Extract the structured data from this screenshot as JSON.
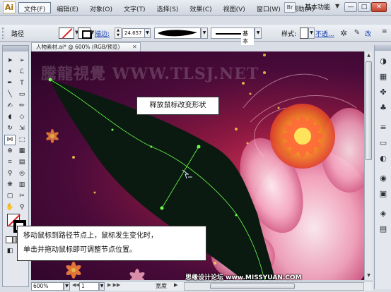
{
  "app": {
    "logo": "Ai",
    "workspace": "基本功能",
    "bridge": "Br"
  },
  "menu": [
    "文件(F)",
    "编辑(E)",
    "对象(O)",
    "文字(T)",
    "选择(S)",
    "效果(C)",
    "视图(V)",
    "窗口(W)",
    "帮助(H)"
  ],
  "window_controls": {
    "minimize": "—",
    "maximize": "□",
    "close": "✕"
  },
  "controlbar": {
    "object_type": "路径",
    "stroke_label": "描边:",
    "stroke_weight": "24.657",
    "profile_label": "基本",
    "style_label": "样式:",
    "opacity_label": "不透...",
    "style_text": "改",
    "menu": "≡"
  },
  "document": {
    "tab_title": "人物素材.ai* @ 600% (RGB/预览)",
    "close": "✕"
  },
  "canvas": {
    "watermark": "騰龍視覺 WWW.TLSJ.NET"
  },
  "callouts": {
    "top": "释放鼠标改变形状",
    "bottom_line1": "移动鼠标到路径节点上，鼠标发生变化时，",
    "bottom_line2": "单击并拖动鼠标即可调整节点位置。"
  },
  "statusbar": {
    "zoom": "600%",
    "page": "1",
    "status": "宽度",
    "site": "思缘设计论坛 www.MISSYUAN.COM"
  },
  "icons": {
    "gear": "gear-icon",
    "graphic_style": "graphic-style-icon"
  },
  "colors": {
    "accent_link": "#1740b0",
    "path_stroke": "#6cff4a",
    "shape_fill": "#0b1a10"
  }
}
